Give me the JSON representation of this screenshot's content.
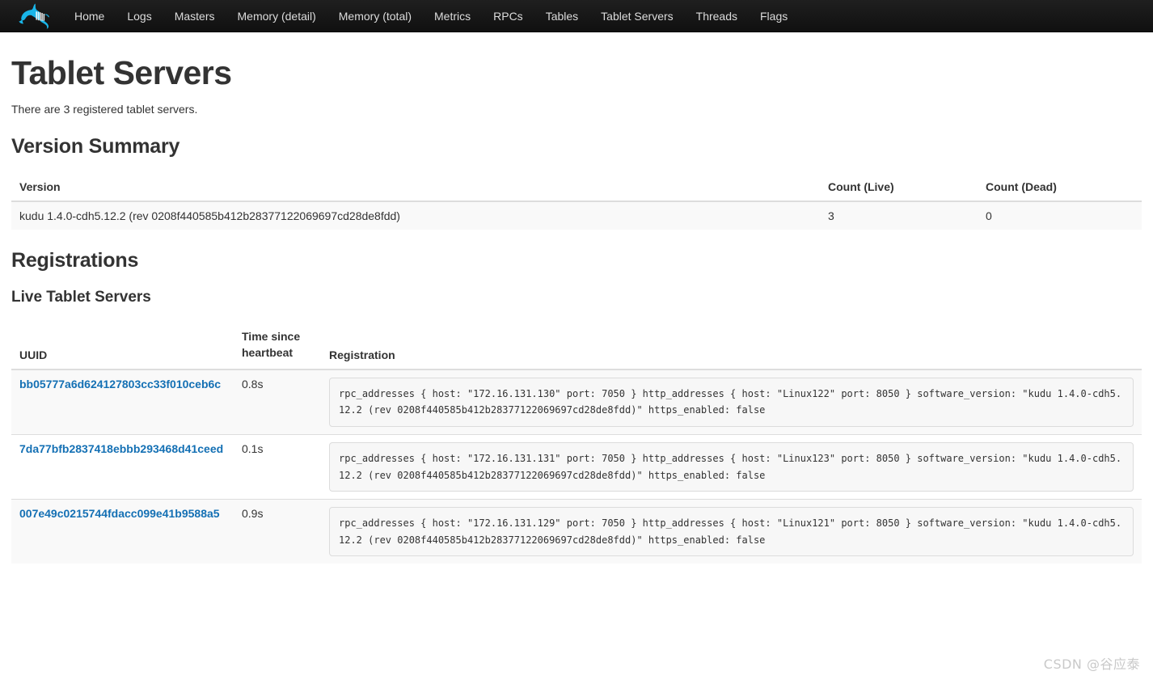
{
  "navbar": {
    "logo_name": "kudu-antelope-logo",
    "logo_color": "#19b5e8",
    "background": "#171717",
    "links": [
      {
        "label": "Home"
      },
      {
        "label": "Logs"
      },
      {
        "label": "Masters"
      },
      {
        "label": "Memory (detail)"
      },
      {
        "label": "Memory (total)"
      },
      {
        "label": "Metrics"
      },
      {
        "label": "RPCs"
      },
      {
        "label": "Tables"
      },
      {
        "label": "Tablet Servers"
      },
      {
        "label": "Threads"
      },
      {
        "label": "Flags"
      }
    ]
  },
  "page": {
    "title": "Tablet Servers",
    "lead": "There are 3 registered tablet servers."
  },
  "version_summary": {
    "heading": "Version Summary",
    "columns": {
      "version": "Version",
      "count_live": "Count (Live)",
      "count_dead": "Count (Dead)"
    },
    "rows": [
      {
        "version": "kudu 1.4.0-cdh5.12.2 (rev 0208f440585b412b28377122069697cd28de8fdd)",
        "count_live": "3",
        "count_dead": "0"
      }
    ]
  },
  "registrations": {
    "heading": "Registrations",
    "subheading": "Live Tablet Servers",
    "columns": {
      "uuid": "UUID",
      "heartbeat": "Time since heartbeat",
      "registration": "Registration"
    },
    "rows": [
      {
        "uuid": "bb05777a6d624127803cc33f010ceb6c",
        "heartbeat": "0.8s",
        "registration": "rpc_addresses { host: \"172.16.131.130\" port: 7050 } http_addresses { host: \"Linux122\" port: 8050 } software_version: \"kudu 1.4.0-cdh5.12.2 (rev 0208f440585b412b28377122069697cd28de8fdd)\" https_enabled: false"
      },
      {
        "uuid": "7da77bfb2837418ebbb293468d41ceed",
        "heartbeat": "0.1s",
        "registration": "rpc_addresses { host: \"172.16.131.131\" port: 7050 } http_addresses { host: \"Linux123\" port: 8050 } software_version: \"kudu 1.4.0-cdh5.12.2 (rev 0208f440585b412b28377122069697cd28de8fdd)\" https_enabled: false"
      },
      {
        "uuid": "007e49c0215744fdacc099e41b9588a5",
        "heartbeat": "0.9s",
        "registration": "rpc_addresses { host: \"172.16.131.129\" port: 7050 } http_addresses { host: \"Linux121\" port: 8050 } software_version: \"kudu 1.4.0-cdh5.12.2 (rev 0208f440585b412b28377122069697cd28de8fdd)\" https_enabled: false"
      }
    ]
  },
  "watermark": {
    "text": "CSDN @谷应泰"
  },
  "colors": {
    "link": "#1470b4",
    "navbar_bg": "#171717",
    "row_alt_bg": "#f9f9f9",
    "border": "#dddddd"
  }
}
